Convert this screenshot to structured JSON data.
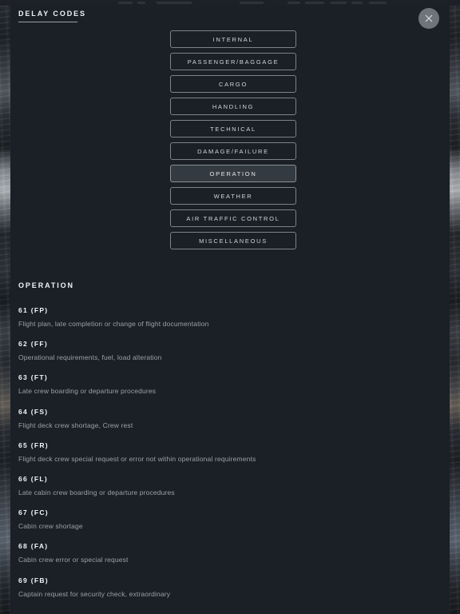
{
  "app": {
    "background_color": "#10141a",
    "panel_color": "#1b1f26",
    "accent_color": "#7d838b",
    "active_button_color": "#343a42",
    "text_primary": "#f0f2f4",
    "text_muted": "#9ba1a8"
  },
  "header": {
    "title": "DELAY CODES",
    "close_icon": "close-icon"
  },
  "categories": [
    {
      "label": "INTERNAL",
      "active": false
    },
    {
      "label": "PASSENGER/BAGGAGE",
      "active": false
    },
    {
      "label": "CARGO",
      "active": false
    },
    {
      "label": "HANDLING",
      "active": false
    },
    {
      "label": "TECHNICAL",
      "active": false
    },
    {
      "label": "DAMAGE/FAILURE",
      "active": false
    },
    {
      "label": "OPERATION",
      "active": true
    },
    {
      "label": "WEATHER",
      "active": false
    },
    {
      "label": "AIR TRAFFIC CONTROL",
      "active": false
    },
    {
      "label": "MISCELLANEOUS",
      "active": false
    }
  ],
  "detail": {
    "section_title": "OPERATION",
    "codes": [
      {
        "code": "61 (FP)",
        "description": "Flight plan, late completion or change of flight documentation"
      },
      {
        "code": "62 (FF)",
        "description": "Operational requirements, fuel, load alteration"
      },
      {
        "code": "63 (FT)",
        "description": "Late crew boarding or departure procedures"
      },
      {
        "code": "64 (FS)",
        "description": "Flight deck crew shortage, Crew rest"
      },
      {
        "code": "65 (FR)",
        "description": "Flight deck crew special request or error not within operational requirements"
      },
      {
        "code": "66 (FL)",
        "description": "Late cabin crew boarding or departure procedures"
      },
      {
        "code": "67 (FC)",
        "description": "Cabin crew shortage"
      },
      {
        "code": "68 (FA)",
        "description": "Cabin crew error or special request"
      },
      {
        "code": "69 (FB)",
        "description": "Captain request for security check, extraordinary"
      }
    ]
  }
}
